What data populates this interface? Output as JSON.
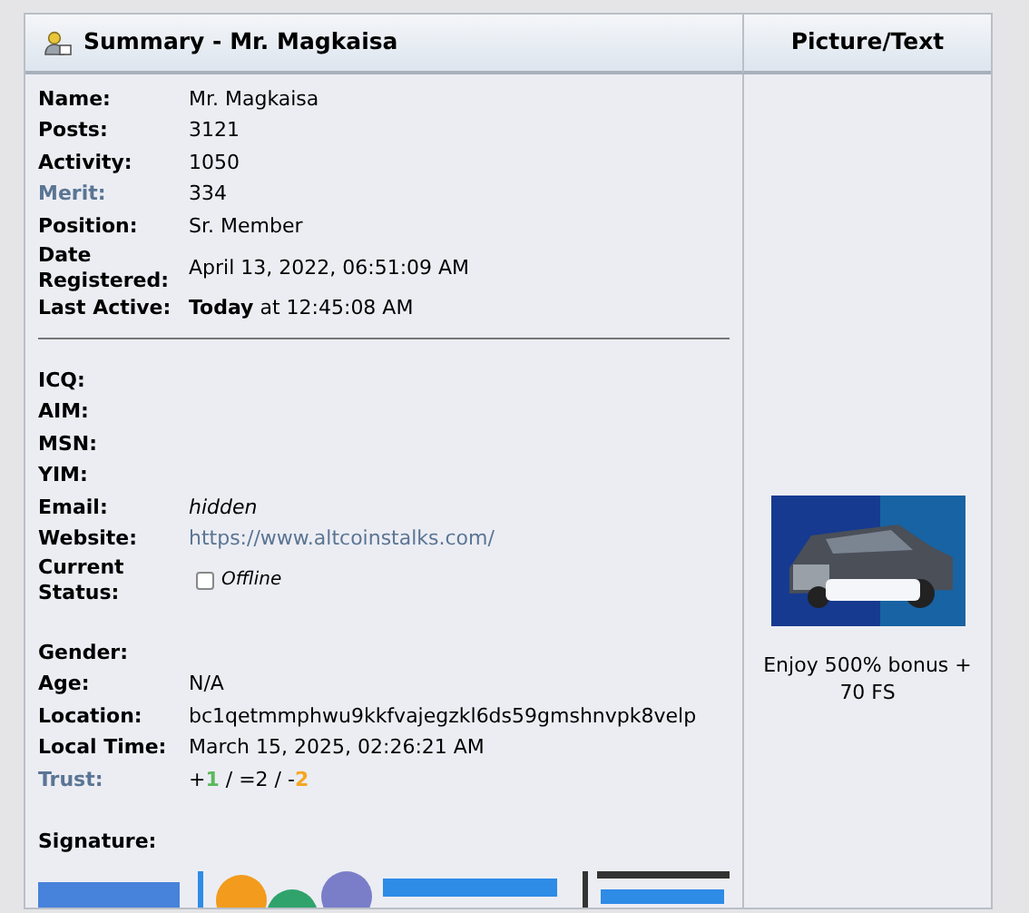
{
  "summary": {
    "title": "Summary - Mr. Magkaisa",
    "sections": [
      {
        "divider": true,
        "rows": [
          {
            "label": "Name:",
            "value": "Mr. Magkaisa"
          },
          {
            "label": "Posts:",
            "value": "3121"
          },
          {
            "label": "Activity:",
            "value": "1050"
          },
          {
            "label": "Merit:",
            "label_link": true,
            "value": "334"
          },
          {
            "label": "Position:",
            "value": "Sr. Member"
          },
          {
            "label": "Date Registered:",
            "value": "April 13, 2022, 06:51:09 AM"
          },
          {
            "label": "Last Active:",
            "value": "**Today** at 12:45:08 AM"
          }
        ]
      },
      {
        "divider": false,
        "rows": [
          {
            "label": "ICQ:"
          },
          {
            "label": "AIM:"
          },
          {
            "label": "MSN:"
          },
          {
            "label": "YIM:"
          },
          {
            "label": "Email:",
            "value": "hidden",
            "kind": "italic"
          },
          {
            "label": "Website:",
            "value": "https://www.altcoinstalks.com/",
            "kind": "link"
          },
          {
            "label": "Current Status:",
            "kind": "status",
            "online": false,
            "value": "Offline"
          }
        ]
      },
      {
        "divider": false,
        "rows": [
          {
            "label": "Gender:"
          },
          {
            "label": "Age:",
            "value": "N/A"
          },
          {
            "label": "Location:",
            "value": "bc1qetmmphwu9kkfvajegzkl6ds59gmshnvpk8velp"
          },
          {
            "label": "Local Time:",
            "value": "March 15, 2025, 02:26:21 AM"
          },
          {
            "label": "Trust:",
            "label_link": true,
            "kind": "trust",
            "parts": [
              {
                "text": "+"
              },
              {
                "text": "1",
                "color": "#5cb85c"
              },
              {
                "text": " / =2 / -"
              },
              {
                "text": "2",
                "color": "#f5a623"
              }
            ]
          }
        ]
      }
    ],
    "signature": {
      "label": "Signature:"
    }
  },
  "picture_text": {
    "title": "Picture/Text",
    "caption": "Enjoy 500% bonus + 70 FS"
  }
}
